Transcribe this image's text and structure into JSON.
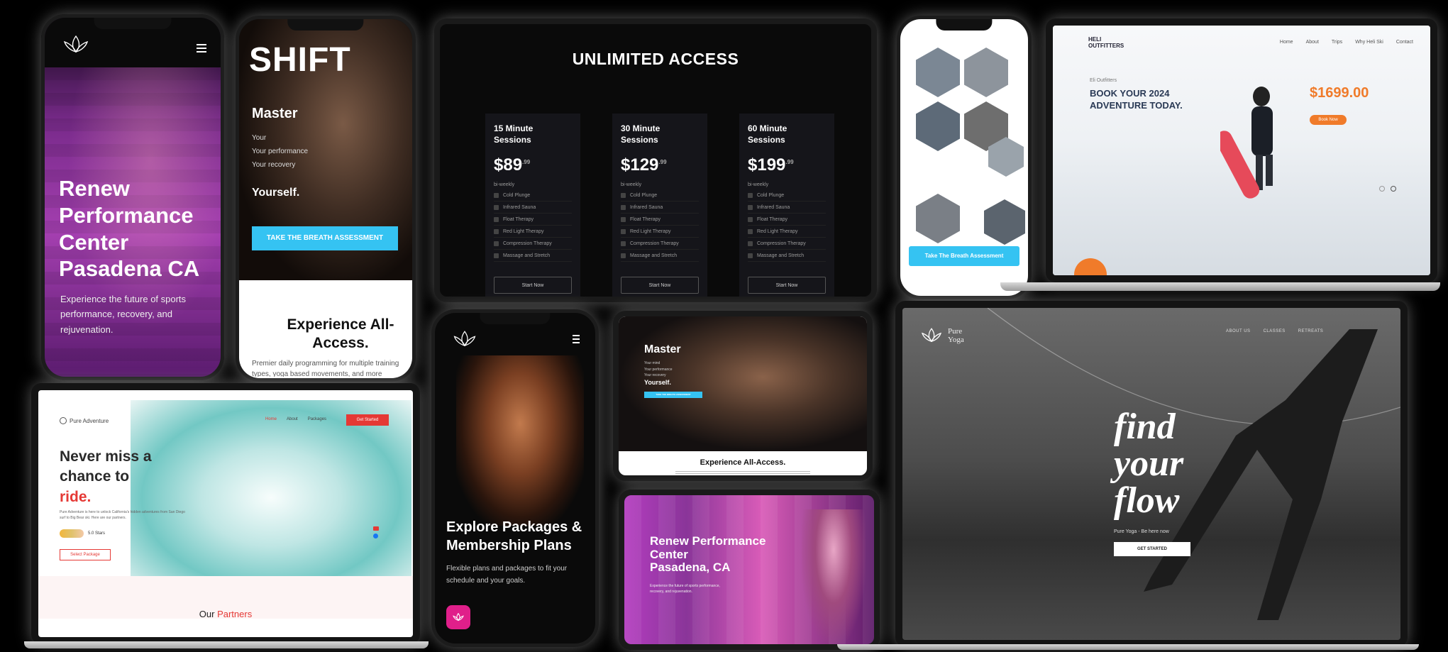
{
  "renew_phone": {
    "title_lines": [
      "Renew",
      "Performance",
      "Center",
      "Pasadena CA"
    ],
    "subtitle": "Experience the future of sports performance, recovery, and rejuvenation."
  },
  "shift_phone": {
    "logo": "SHIFT",
    "heading": "Master",
    "lines": [
      "Your",
      "Your performance",
      "Your recovery"
    ],
    "yourself": "Yourself.",
    "cta": "TAKE THE BREATH ASSESSMENT",
    "section_title": "Experience All-Access.",
    "section_body": "Premier daily programming for multiple training types, yoga based movements, and more"
  },
  "pricing": {
    "title": "UNLIMITED ACCESS",
    "cards": [
      {
        "name_line1": "15 Minute",
        "name_line2": "Sessions",
        "price": "$89",
        "cents": ".99",
        "period": "bi-weekly",
        "button": "Start Now"
      },
      {
        "name_line1": "30 Minute",
        "name_line2": "Sessions",
        "price": "$129",
        "cents": ".99",
        "period": "bi-weekly",
        "button": "Start Now"
      },
      {
        "name_line1": "60 Minute",
        "name_line2": "Sessions",
        "price": "$199",
        "cents": ".99",
        "period": "bi-weekly",
        "button": "Start Now"
      }
    ],
    "features": [
      "Cold Plunge",
      "Infrared Sauna",
      "Float Therapy",
      "Red Light Therapy",
      "Compression Therapy",
      "Massage and Stretch"
    ]
  },
  "team_phone": {
    "cta": "Take The Breath Assessment"
  },
  "heli": {
    "logo": "HELI OUTFITTERS",
    "nav": [
      "Home",
      "About",
      "Trips",
      "Why Heli Ski",
      "Contact"
    ],
    "kicker": "Eli Outfitters",
    "headline_line1": "BOOK YOUR 2024",
    "headline_line2": "ADVENTURE TODAY.",
    "price": "$1699.00",
    "button": "Book Now"
  },
  "pure_adventure": {
    "logo": "Pure Adventure",
    "nav": [
      "Home",
      "About",
      "Packages"
    ],
    "nav_cta": "Get Started",
    "headline_line1": "Never miss a",
    "headline_line2": "chance to",
    "headline_line3": "ride.",
    "body": "Pure Adventure is here to unlock California's hidden adventures from San Diego surf to Big Bear ski. Here are our partners.",
    "rating": "5.0 Stars",
    "button": "Select Package",
    "partners_prefix": "Our",
    "partners_word": "Partners",
    "accent": "#e53935"
  },
  "explore_phone": {
    "title_line1": "Explore Packages &",
    "title_line2": "Membership Plans",
    "body": "Flexible plans and packages to fit your schedule and your goals."
  },
  "shift_tablet": {
    "heading": "Master",
    "lines": [
      "Your mind",
      "Your performance",
      "Your recovery"
    ],
    "yourself": "Yourself.",
    "cta": "TAKE THE BREATH ASSESSMENT",
    "section_title": "Experience All-Access."
  },
  "renew_tablet": {
    "title_lines": [
      "Renew Performance",
      "Center",
      "Pasadena, CA"
    ],
    "subtitle": "Experience the future of sports performance, recovery, and rejuvenation."
  },
  "pure_yoga": {
    "logo_line1": "Pure",
    "logo_line2": "Yoga",
    "nav": [
      "ABOUT US",
      "CLASSES",
      "RETREATS"
    ],
    "headline": [
      "find",
      "your",
      "flow"
    ],
    "tagline": "Pure Yoga - Be here now",
    "button": "GET STARTED"
  }
}
